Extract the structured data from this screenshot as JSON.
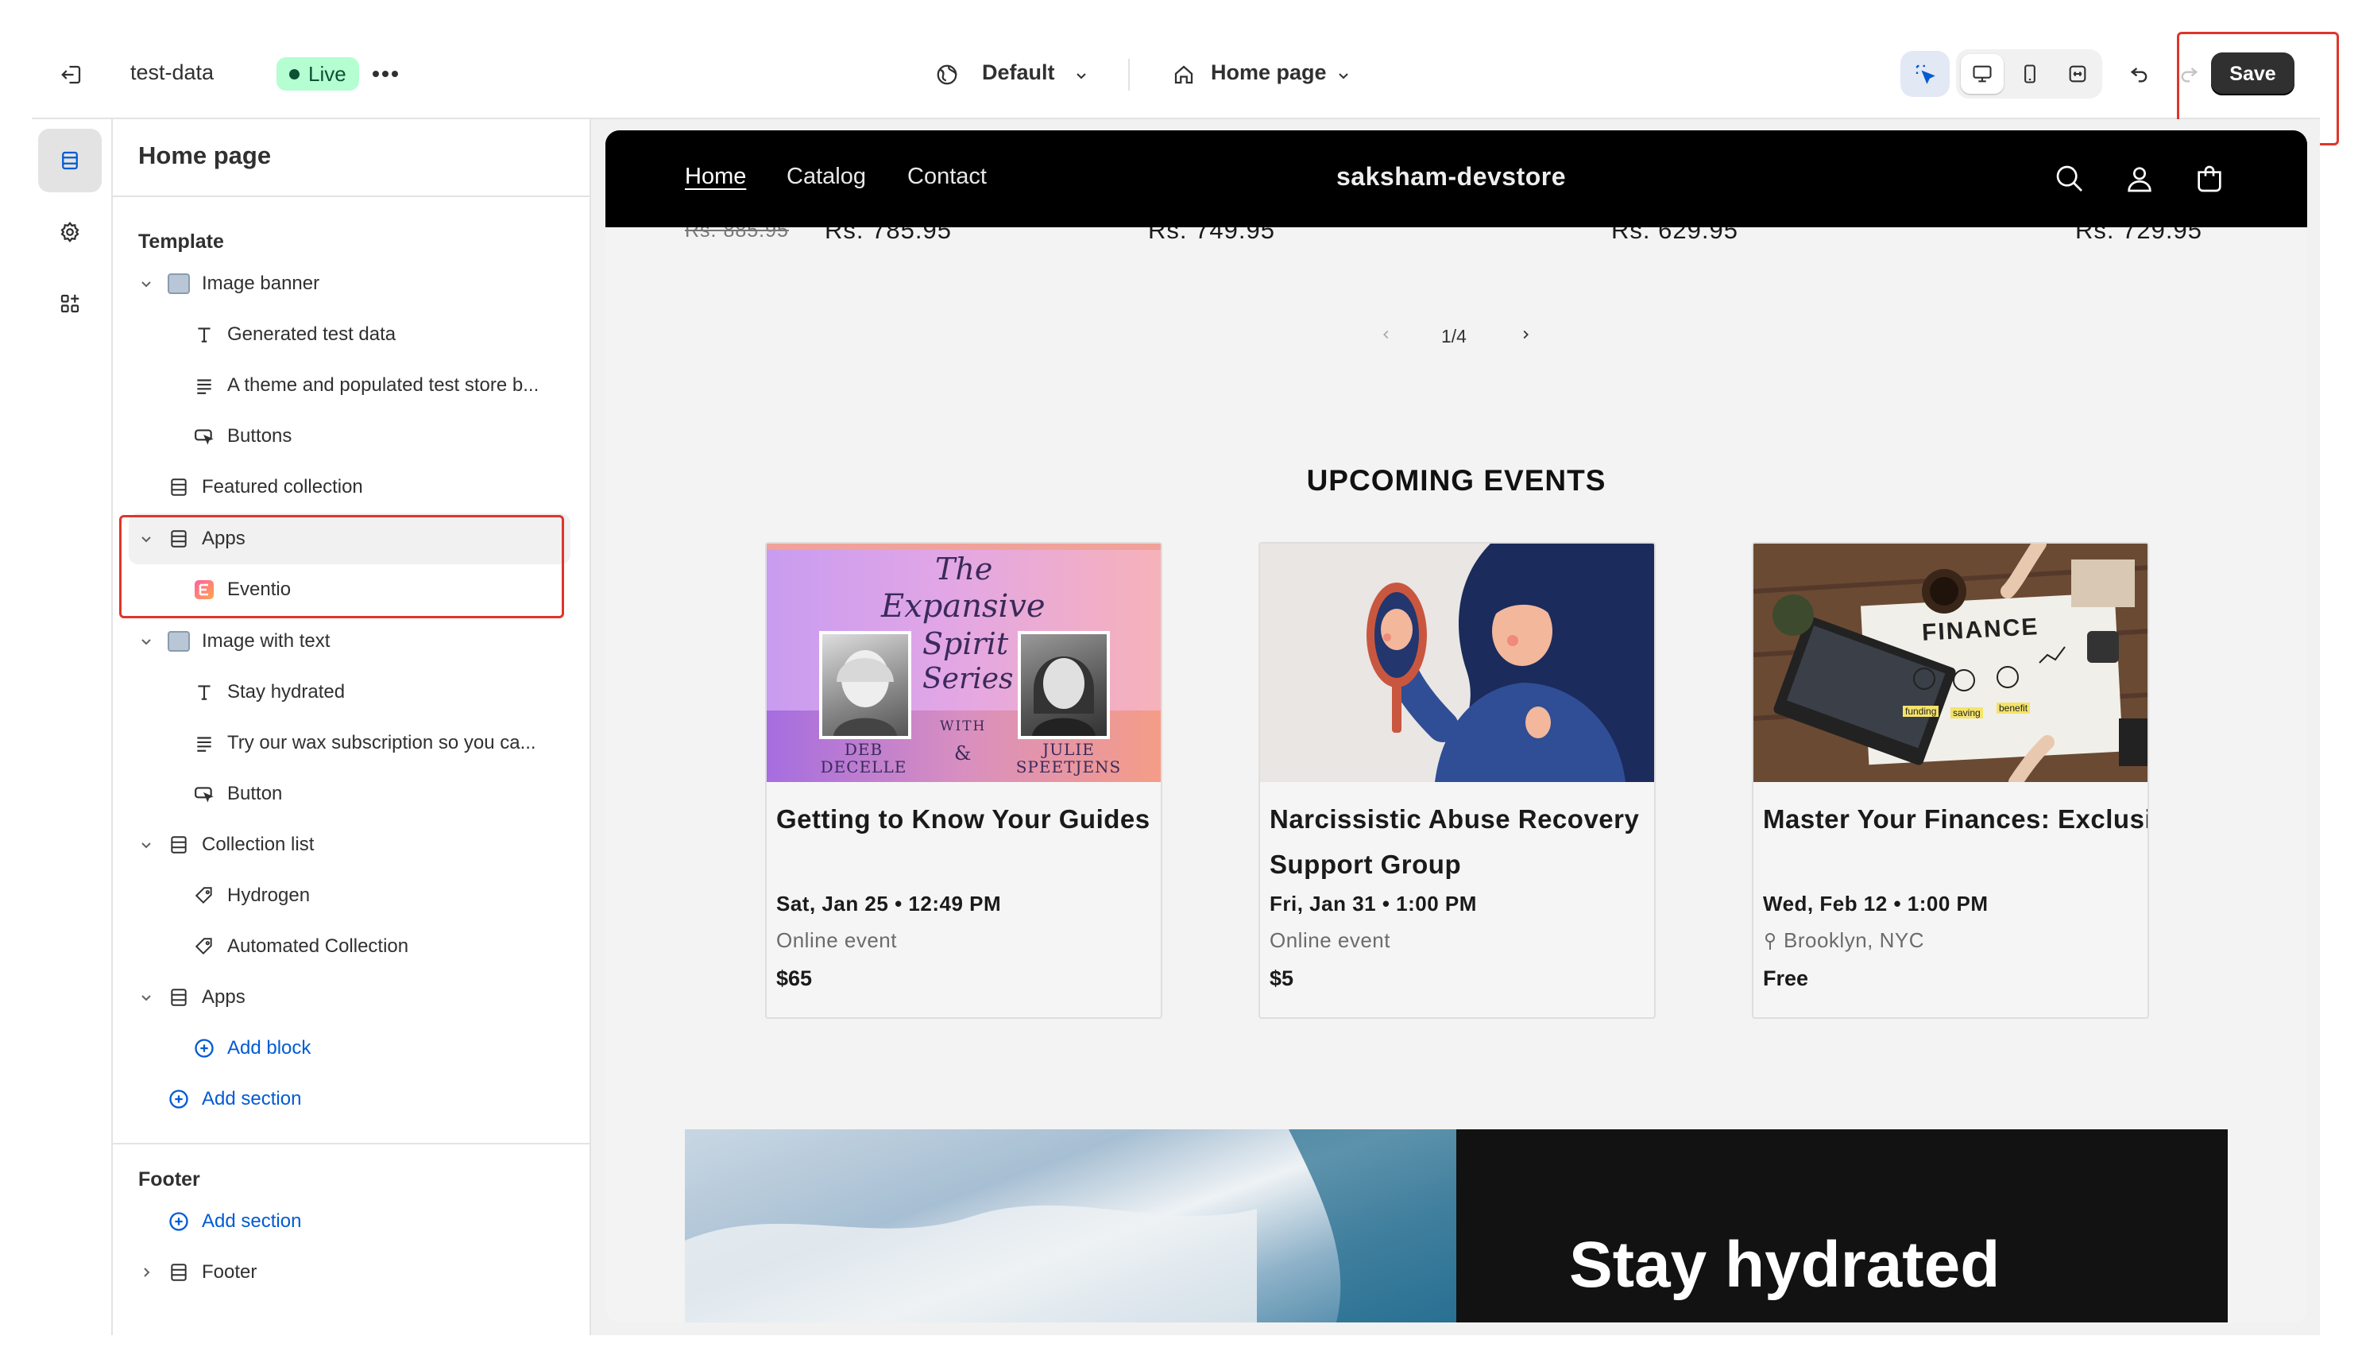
{
  "topbar": {
    "store_name": "test-data",
    "status": "Live",
    "theme": "Default",
    "page": "Home page",
    "save": "Save"
  },
  "sidebar": {
    "title": "Home page",
    "template_label": "Template",
    "items": [
      {
        "label": "Image banner"
      },
      {
        "label": "Generated test data"
      },
      {
        "label": "A theme and populated test store b..."
      },
      {
        "label": "Buttons"
      },
      {
        "label": "Featured collection"
      },
      {
        "label": "Apps"
      },
      {
        "label": "Eventio"
      },
      {
        "label": "Image with text"
      },
      {
        "label": "Stay hydrated"
      },
      {
        "label": "Try our wax subscription so you ca..."
      },
      {
        "label": "Button"
      },
      {
        "label": "Collection list"
      },
      {
        "label": "Hydrogen"
      },
      {
        "label": "Automated Collection"
      },
      {
        "label": "Apps"
      },
      {
        "label": "Add block"
      },
      {
        "label": "Add section"
      }
    ],
    "footer_label": "Footer",
    "footer_add_section": "Add section",
    "footer_item": "Footer"
  },
  "preview": {
    "nav": [
      "Home",
      "Catalog",
      "Contact"
    ],
    "brand": "saksham-devstore",
    "prices": {
      "old": "Rs. 885.95",
      "p1": "Rs. 785.95",
      "p2": "Rs. 749.95",
      "p3": "Rs. 629.95",
      "p4": "Rs. 729.95"
    },
    "pagination": "1/4",
    "events_heading": "UPCOMING EVENTS",
    "events": [
      {
        "title": "Getting to Know Your Guides",
        "date": "Sat, Jan 25 • 12:49 PM",
        "location": "Online event",
        "price": "$65",
        "poster": {
          "line1": "The",
          "line2": "Expansive",
          "line3": "Spirit",
          "line4": "Series",
          "with": "WITH",
          "amp": "&",
          "name1": "DEB DECELLE",
          "name2": "JULIE SPEETJENS"
        }
      },
      {
        "title": "Narcissistic Abuse Recovery Support Group",
        "date": "Fri, Jan 31 • 1:00 PM",
        "location": "Online event",
        "price": "$5"
      },
      {
        "title": "Master Your Finances: Exclusive Networking and ...",
        "date": "Wed, Feb 12 • 1:00 PM",
        "location": "Brooklyn, NYC",
        "price": "Free",
        "poster": {
          "word": "FINANCE",
          "l1": "funding",
          "l2": "saving",
          "l3": "benefit"
        }
      }
    ],
    "banner_text": "Stay hydrated"
  }
}
